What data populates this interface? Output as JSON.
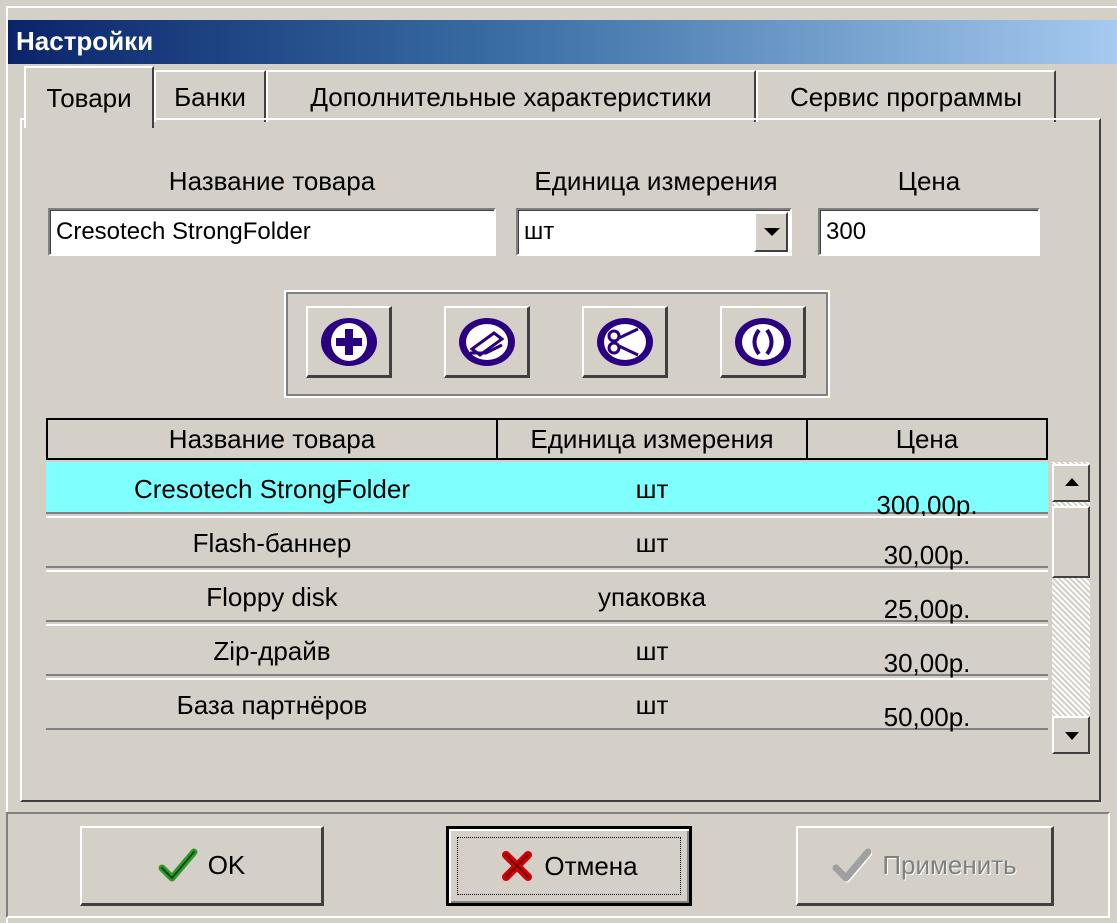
{
  "window": {
    "title": "Настройки"
  },
  "tabs": [
    {
      "label": "Товари",
      "active": true
    },
    {
      "label": "Банки",
      "active": false
    },
    {
      "label": "Дополнительные характеристики",
      "active": false
    },
    {
      "label": "Сервис программы",
      "active": false
    }
  ],
  "form": {
    "name_label": "Название товара",
    "name_value": "Cresotech StrongFolder",
    "unit_label": "Единица измерения",
    "unit_value": "шт",
    "price_label": "Цена",
    "price_value": "300"
  },
  "toolbar": {
    "buttons": [
      {
        "icon": "add-icon"
      },
      {
        "icon": "edit-icon"
      },
      {
        "icon": "delete-icon"
      },
      {
        "icon": "refresh-icon"
      }
    ]
  },
  "table": {
    "headers": [
      "Название товара",
      "Единица измерения",
      "Цена"
    ],
    "rows": [
      {
        "name": "Cresotech StrongFolder",
        "unit": "шт",
        "price": "300,00р.",
        "selected": true
      },
      {
        "name": "Flash-баннер",
        "unit": "шт",
        "price": "30,00р."
      },
      {
        "name": "Floppy disk",
        "unit": "упаковка",
        "price": "25,00р."
      },
      {
        "name": "Zip-драйв",
        "unit": "шт",
        "price": "30,00р."
      },
      {
        "name": "База партнёров",
        "unit": "шт",
        "price": "50,00р."
      }
    ],
    "selected_color": "#80ffff"
  },
  "dialog_buttons": {
    "ok": "OK",
    "cancel": "Отмена",
    "apply": "Применить"
  },
  "colors": {
    "titlebar_start": "#0a246a",
    "titlebar_end": "#a6caf0",
    "ok_check": "#2e9a2e",
    "cancel_x": "#d00000",
    "icon_purple": "#2b0080"
  }
}
